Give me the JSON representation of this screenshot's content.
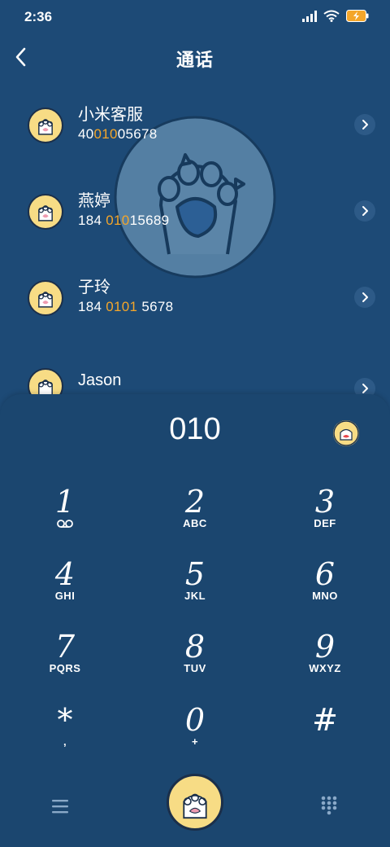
{
  "status": {
    "time": "2:36"
  },
  "header": {
    "title": "通话"
  },
  "contacts": [
    {
      "name": "小米客服",
      "num_pre": "40",
      "num_hl": "010",
      "num_post": "05678"
    },
    {
      "name": "燕婷",
      "num_pre": "184 ",
      "num_hl": "010",
      "num_post": "15689"
    },
    {
      "name": "子玲",
      "num_pre": "184 ",
      "num_hl": "0101",
      "num_post": " 5678"
    },
    {
      "name": "Jason",
      "num_pre": "",
      "num_hl": "",
      "num_post": ""
    }
  ],
  "dialpad": {
    "input": "010",
    "keys": [
      {
        "digit": "1",
        "letters": ""
      },
      {
        "digit": "2",
        "letters": "ABC"
      },
      {
        "digit": "3",
        "letters": "DEF"
      },
      {
        "digit": "4",
        "letters": "GHI"
      },
      {
        "digit": "5",
        "letters": "JKL"
      },
      {
        "digit": "6",
        "letters": "MNO"
      },
      {
        "digit": "7",
        "letters": "PQRS"
      },
      {
        "digit": "8",
        "letters": "TUV"
      },
      {
        "digit": "9",
        "letters": "WXYZ"
      },
      {
        "digit": "*",
        "letters": ","
      },
      {
        "digit": "0",
        "letters": "+"
      },
      {
        "digit": "#",
        "letters": ""
      }
    ]
  },
  "icons": [
    "back-icon",
    "signal-icon",
    "wifi-icon",
    "battery-icon",
    "chevron-right-icon",
    "paw-avatar-icon",
    "voicemail-icon",
    "menu-icon",
    "call-icon",
    "keypad-icon"
  ],
  "colors": {
    "background": "#1d4a76",
    "dialpad": "#1b466f",
    "highlight": "#f4a62a",
    "avatar": "#f7dc85"
  }
}
